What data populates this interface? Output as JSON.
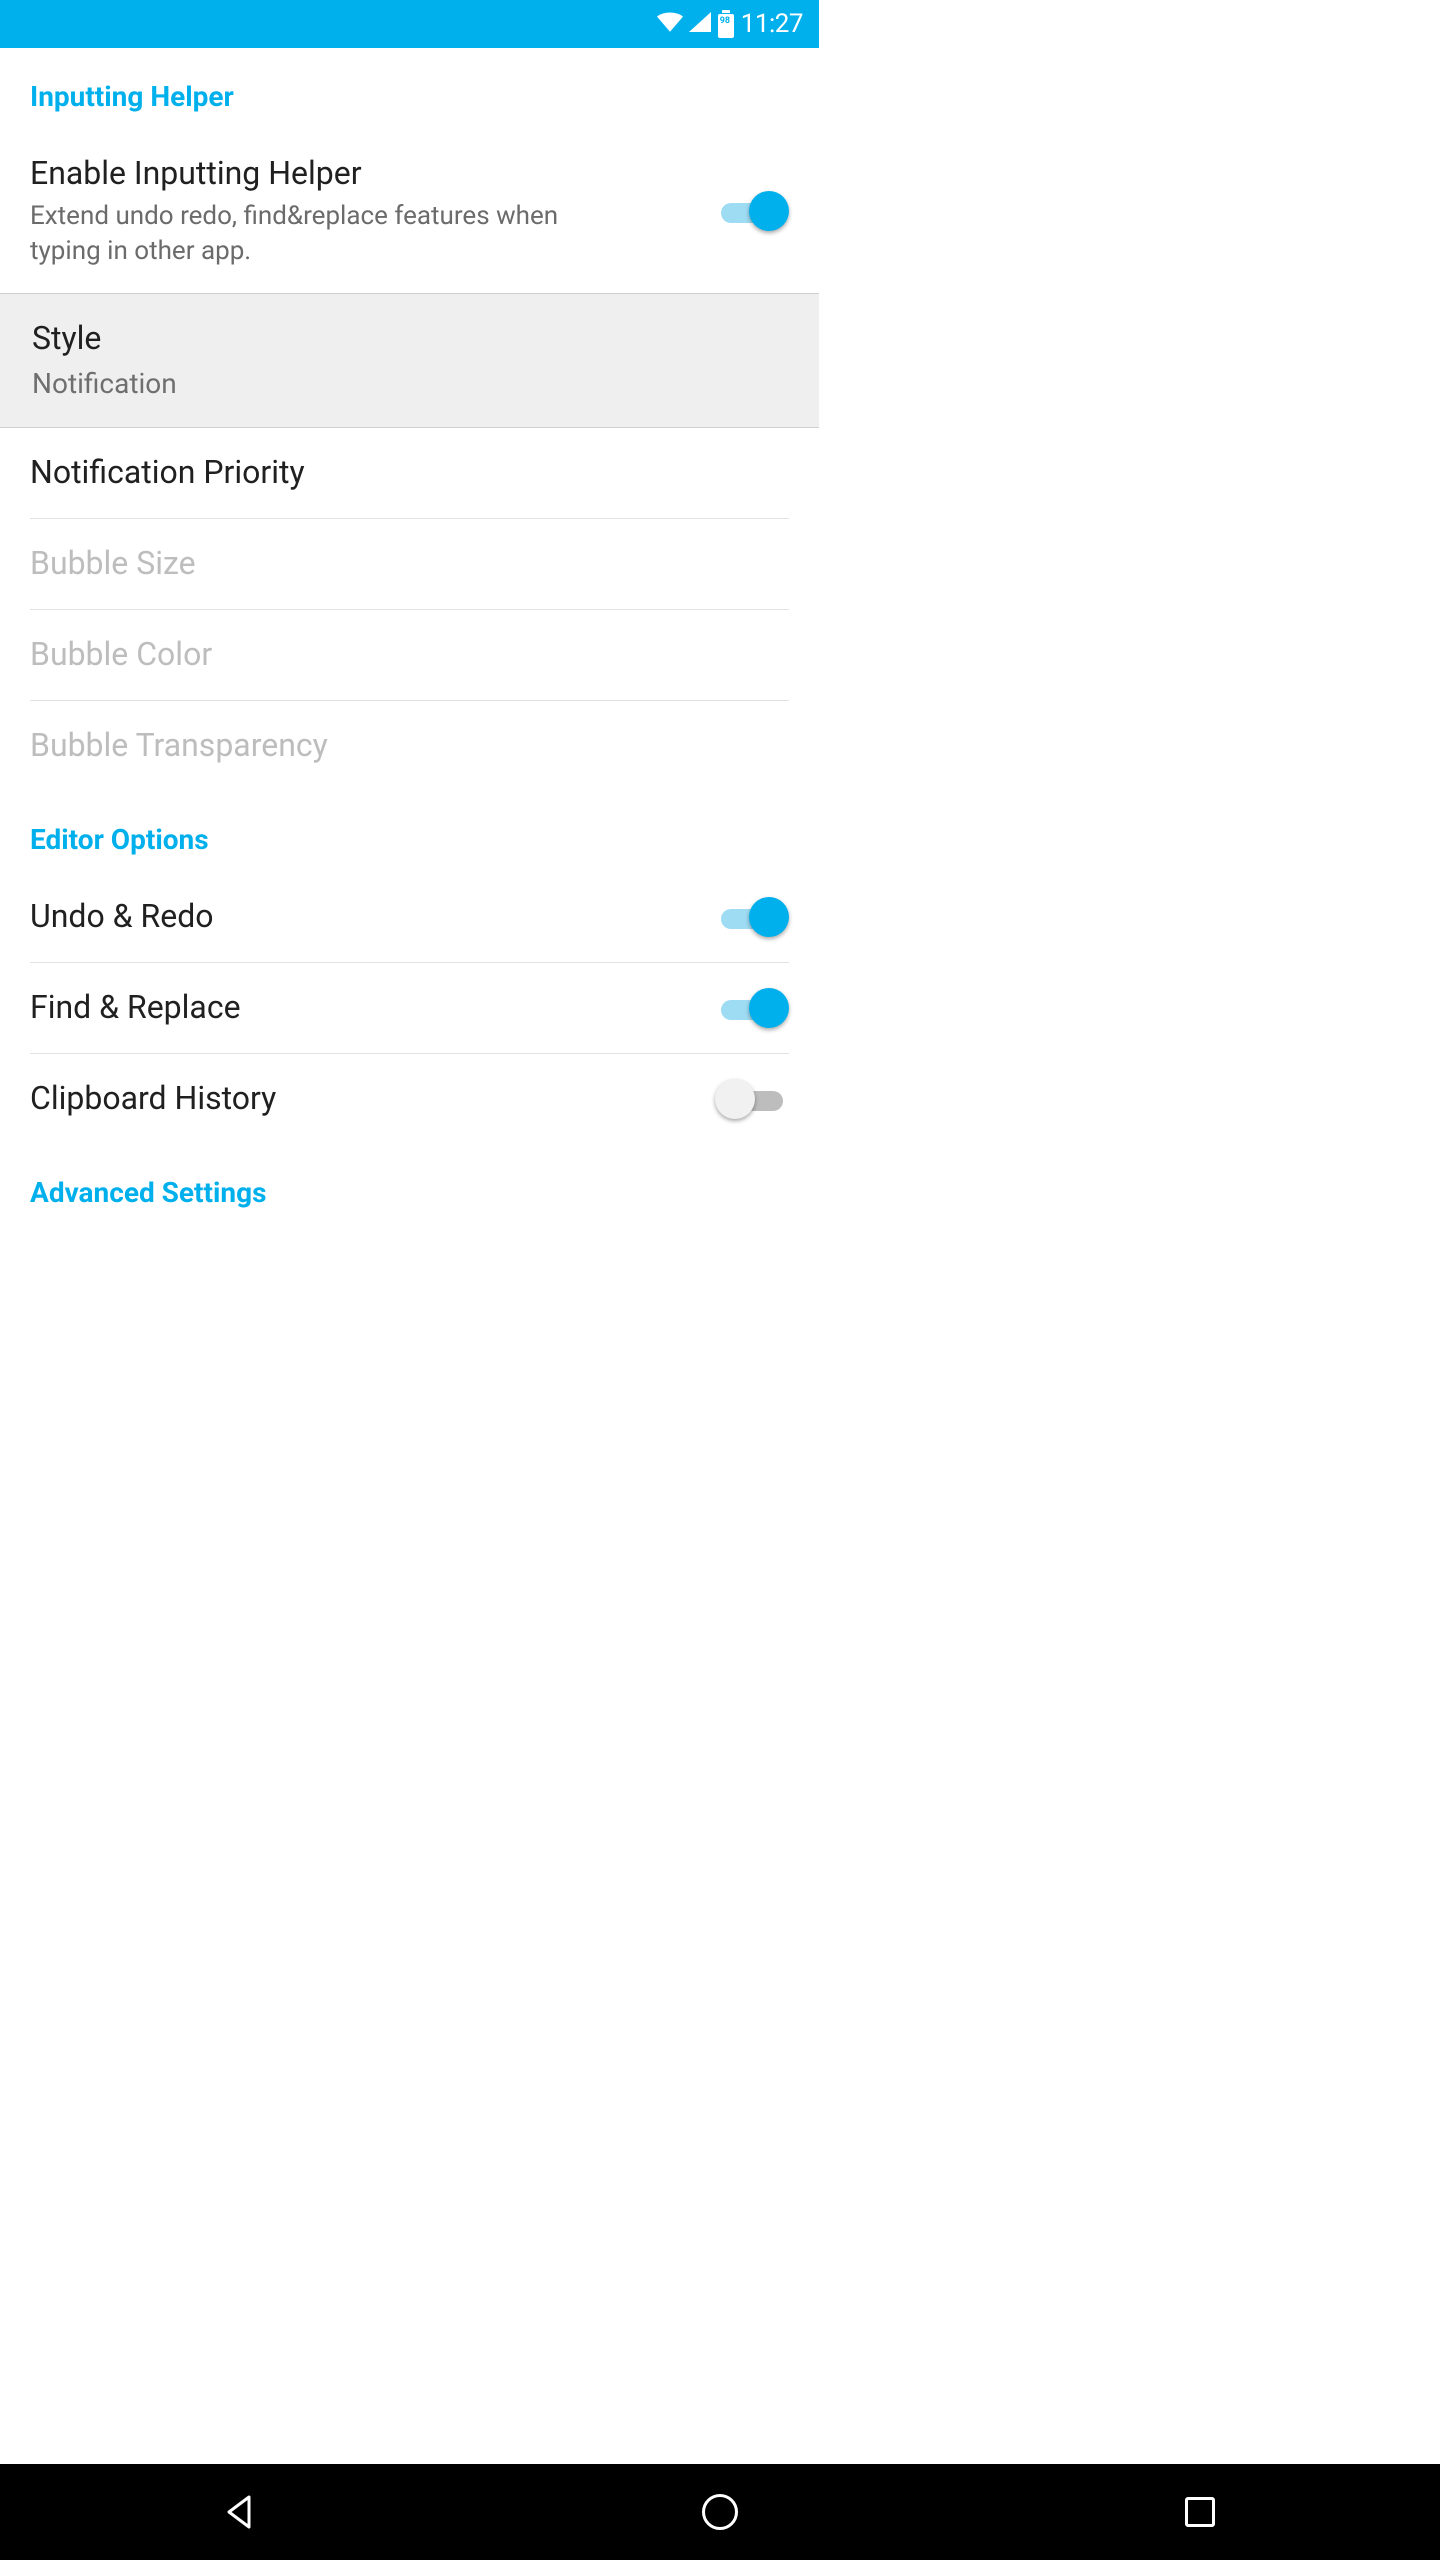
{
  "status": {
    "time": "11:27",
    "battery_pct": "98"
  },
  "sections": {
    "inputting_helper": {
      "header": "Inputting Helper",
      "enable": {
        "title": "Enable Inputting Helper",
        "sub": "Extend undo redo, find&replace features when typing in other app.",
        "on": true
      },
      "style": {
        "title": "Style",
        "value": "Notification"
      },
      "notification_priority": {
        "title": "Notification Priority"
      },
      "bubble_size": {
        "title": "Bubble Size"
      },
      "bubble_color": {
        "title": "Bubble Color"
      },
      "bubble_transparency": {
        "title": "Bubble Transparency"
      }
    },
    "editor_options": {
      "header": "Editor Options",
      "undo_redo": {
        "title": "Undo & Redo",
        "on": true
      },
      "find_replace": {
        "title": "Find & Replace",
        "on": true
      },
      "clipboard_history": {
        "title": "Clipboard History",
        "on": false
      }
    },
    "advanced": {
      "header": "Advanced Settings"
    }
  }
}
